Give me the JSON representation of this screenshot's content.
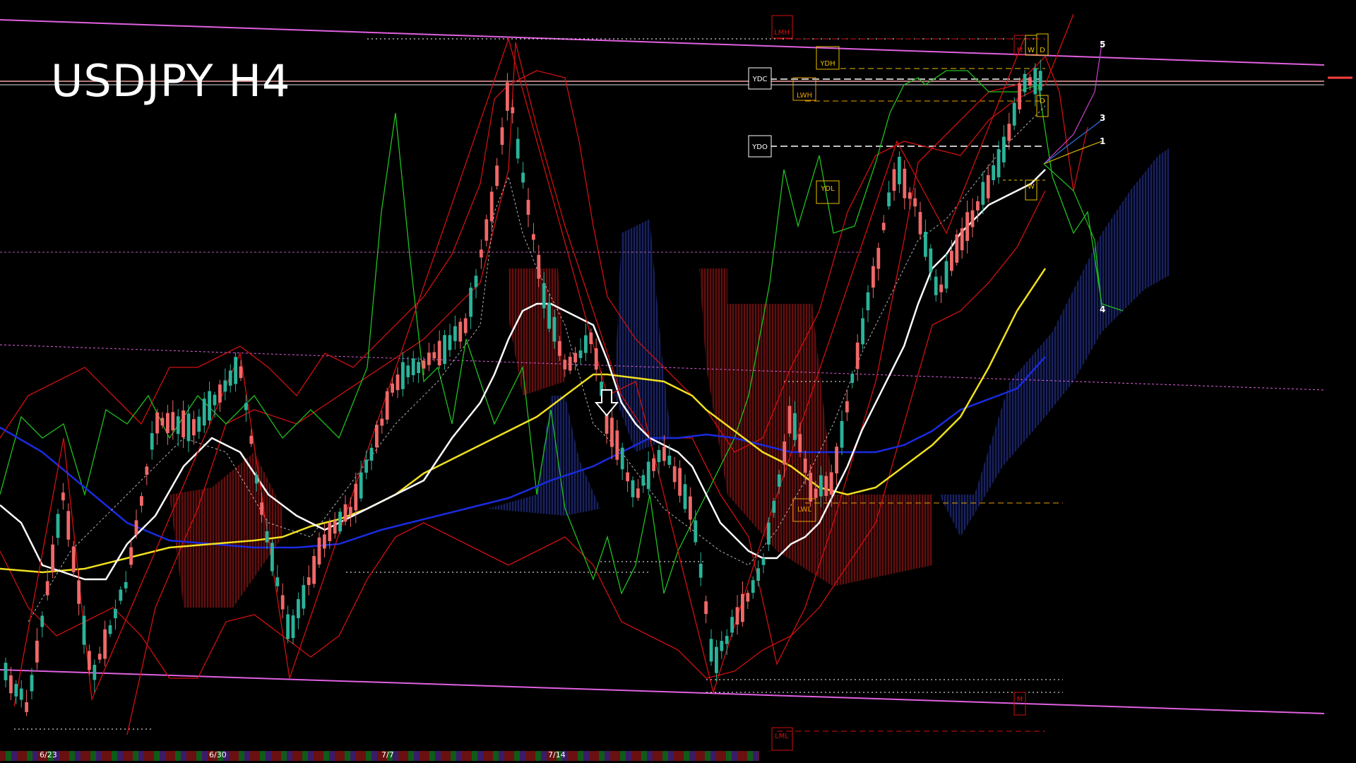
{
  "title": "USDJPY H4",
  "chart_data": {
    "type": "candlestick",
    "symbol": "USDJPY",
    "timeframe": "H4",
    "x_tick_labels": [
      "6/23",
      "6/30",
      "7/7",
      "7/14"
    ],
    "level_boxes": [
      {
        "label": "LMH",
        "color": "#d01010"
      },
      {
        "label": "YDH",
        "color": "#e8c000"
      },
      {
        "label": "YDC",
        "color": "#ffffff"
      },
      {
        "label": "LWH",
        "color": "#e8a000"
      },
      {
        "label": "YDO",
        "color": "#ffffff"
      },
      {
        "label": "YDL",
        "color": "#e8c000"
      },
      {
        "label": "LWL",
        "color": "#e8a000"
      },
      {
        "label": "LML",
        "color": "#d01010"
      },
      {
        "label": "M",
        "color": "#d01010"
      },
      {
        "label": "W",
        "color": "#e8c000"
      },
      {
        "label": "D",
        "color": "#e8c000"
      }
    ],
    "wave_labels": [
      "5",
      "3",
      "1",
      "4"
    ],
    "colors": {
      "bull": "#2bb39a",
      "bear": "#f06868",
      "sma_fast": "#ffffff",
      "sma_mid": "#f0e020",
      "sma_slow": "#1a2be0",
      "bollinger": "#d01010",
      "rci": "#20c020",
      "channel": "#e060e0",
      "cloud_bull": "#2a3a9a",
      "cloud_bear": "#a01818"
    },
    "grid": false
  }
}
